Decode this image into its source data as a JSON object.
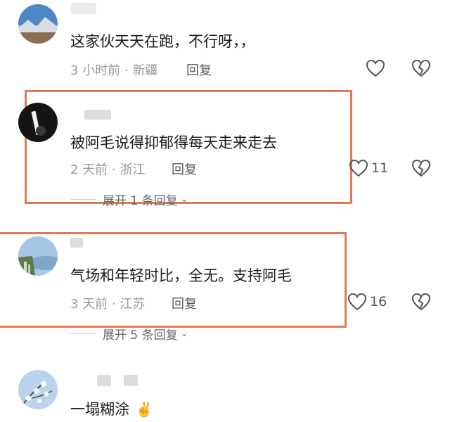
{
  "comments": [
    {
      "text": "这家伙天天在跑，不行呀，，",
      "time": "3 小时前",
      "location": "新疆",
      "reply_label": "回复",
      "likes": ""
    },
    {
      "text": "被阿毛说得抑郁得每天走来走去",
      "time": "2 天前",
      "location": "浙江",
      "reply_label": "回复",
      "likes": "11",
      "expand_label": "展开 1 条回复"
    },
    {
      "text": "气场和年轻时比，全无。支持阿毛",
      "time": "3 天前",
      "location": "江苏",
      "reply_label": "回复",
      "likes": "16",
      "expand_label": "展开 5 条回复"
    },
    {
      "text": "一塌糊涂",
      "emoji": "✌️"
    }
  ],
  "meta_separator": " · ",
  "icons": {
    "like": "heart-outline-icon",
    "dislike": "broken-heart-icon",
    "expand": "chevron-down-icon"
  },
  "colors": {
    "highlight_box": "#e07a55",
    "meta_text": "#9a9a9a",
    "body_text": "#1a1a1a"
  }
}
